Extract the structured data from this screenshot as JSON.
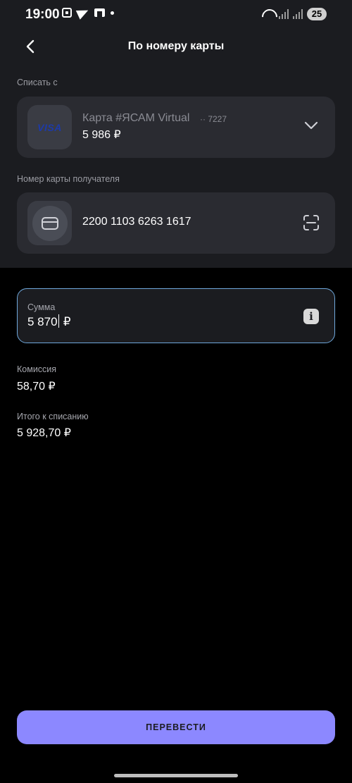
{
  "status_bar": {
    "time": "19:00",
    "battery": "25"
  },
  "header": {
    "title": "По номеру карты"
  },
  "source": {
    "label": "Списать с",
    "card_brand": "VISA",
    "card_name": "Карта #ЯСАМ Virtual",
    "card_mask": "·· 7227",
    "balance": "5 986 ₽"
  },
  "recipient": {
    "label": "Номер карты получателя",
    "card_number": "2200 1103 6263 1617"
  },
  "amount": {
    "label": "Сумма",
    "value_before_cursor": "5 870",
    "currency": "₽"
  },
  "commission": {
    "label": "Комиссия",
    "value": "58,70 ₽"
  },
  "total": {
    "label": "Итого к списанию",
    "value": "5 928,70 ₽"
  },
  "submit": {
    "label": "ПЕРЕВЕСТИ"
  },
  "colors": {
    "accent": "#8c88ff",
    "focus_border": "#6fa8dc",
    "surface": "#1b1c20",
    "card": "#2a2b31"
  }
}
